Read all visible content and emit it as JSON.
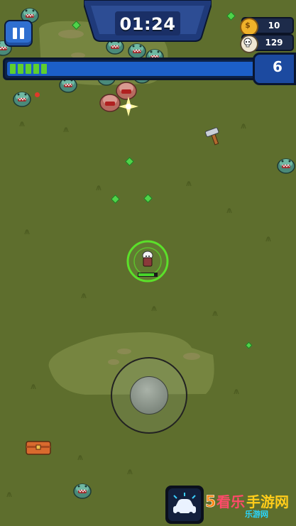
{
  "hud": {
    "timer": "01:24",
    "coins": "10",
    "kills": "129",
    "level": "6",
    "xp_progress_percent": 14
  },
  "watermark": {
    "logo_text": "5看乐手游网",
    "subtitle": "乐游网"
  },
  "icons": [
    "pause-icon",
    "coin-icon",
    "skull-icon",
    "car-icon"
  ],
  "colors": {
    "accent_blue": "#1c5fc8",
    "xp_green": "#5fcf2e",
    "aura_green": "#5be02a",
    "grass": "#5e6e2d"
  }
}
